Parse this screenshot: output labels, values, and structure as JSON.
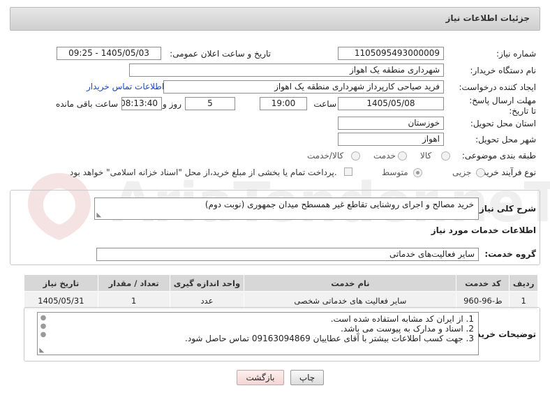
{
  "header": {
    "title": "جزئیات اطلاعات نیاز"
  },
  "watermark": {
    "text": "AriaTender.neT"
  },
  "form": {
    "need_number_label": "شماره نیاز:",
    "need_number": "1105095493000009",
    "announce_label": "تاریخ و ساعت اعلان عمومی:",
    "announce_value": "1405/05/03 - 09:25",
    "buyer_org_label": "نام دستگاه خریدار:",
    "buyer_org": "شهرداری منطقه یک اهواز",
    "creator_label": "ایجاد کننده درخواست:",
    "creator": "فرید صیاحی کارپرداز شهرداری منطقه یک اهواز",
    "contact_link": "اطلاعات تماس خریدار",
    "deadline_label": "مهلت ارسال پاسخ: تا تاریخ:",
    "deadline_date": "1405/05/08",
    "time_label": "ساعت",
    "deadline_time": "19:00",
    "days_value": "5",
    "days_label": "روز و",
    "remaining_value": "08:13:40",
    "remaining_label": "ساعت باقی مانده",
    "province_label": "استان محل تحویل:",
    "province": "خوزستان",
    "city_label": "شهر محل تحویل:",
    "city": "اهواز",
    "category_label": "طبقه بندی موضوعی:",
    "category_options": [
      "کالا",
      "خدمت",
      "کالا/خدمت"
    ],
    "purchase_type_label": "نوع فرآیند خرید :",
    "purchase_options": [
      "جزیی",
      "متوسط"
    ],
    "payment_note": "پرداخت تمام یا بخشی از مبلغ خرید،از محل \"اسناد خزانه اسلامی\" خواهد بود."
  },
  "description": {
    "label": "شرح کلی نیاز:",
    "value": "خرید مصالح و اجرای روشنایی تقاطع غیر همسطح میدان جمهوری (نوبت دوم)"
  },
  "services_title": "اطلاعات خدمات مورد نیاز",
  "service_group": {
    "label": "گروه خدمت:",
    "value": "سایر فعالیت‌های خدماتی"
  },
  "table": {
    "headers": [
      "ردیف",
      "کد خدمت",
      "نام خدمت",
      "واحد اندازه گیری",
      "تعداد / مقدار",
      "تاریخ نیاز"
    ],
    "rows": [
      [
        "1",
        "ط-96-960",
        "سایر فعالیت های خدماتی شخصی",
        "عدد",
        "1",
        "1405/05/31"
      ]
    ]
  },
  "notes": {
    "label": "توضیحات خریدار:",
    "lines": [
      "1. از ایران کد مشابه استفاده شده است.",
      "2. اسناد و مدارک به پیوست می باشد.",
      "3. جهت کسب اطلاعات بیشتر با آقای عطاییان 09163094869 تماس حاصل شود."
    ]
  },
  "buttons": {
    "print": "چاپ",
    "back": "بازگشت"
  }
}
